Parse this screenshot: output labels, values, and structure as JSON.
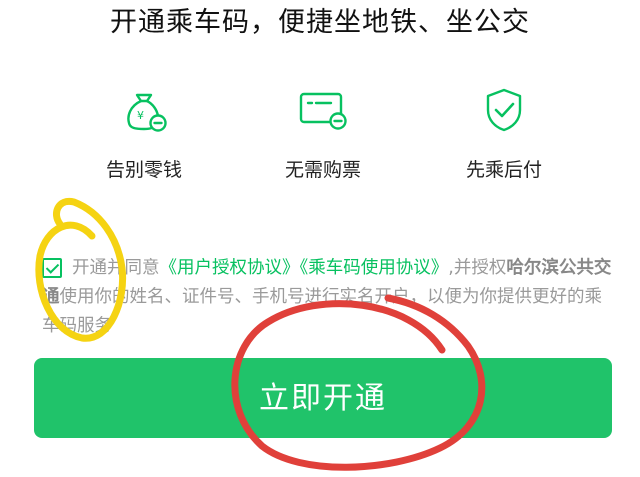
{
  "header": {
    "title": "开通乘车码，便捷坐地铁、坐公交"
  },
  "features": [
    {
      "icon": "money-bag-icon",
      "label": "告别零钱"
    },
    {
      "icon": "ticket-icon",
      "label": "无需购票"
    },
    {
      "icon": "shield-check-icon",
      "label": "先乘后付"
    }
  ],
  "agreement": {
    "checked": true,
    "prefix": "开通并同意",
    "link1": "《用户授权协议》",
    "link2": "《乘车码使用协议》",
    "mid": ",并授权",
    "org": "哈尔滨公共交通",
    "suffix": "使用你的姓名、证件号、手机号进行实名开户，以便为你提供更好的乘车码服务"
  },
  "button": {
    "label": "立即开通"
  },
  "colors": {
    "accent": "#07c160",
    "button": "#20c36a",
    "annotation_yellow": "#f5d312",
    "annotation_red": "#e0403a"
  }
}
